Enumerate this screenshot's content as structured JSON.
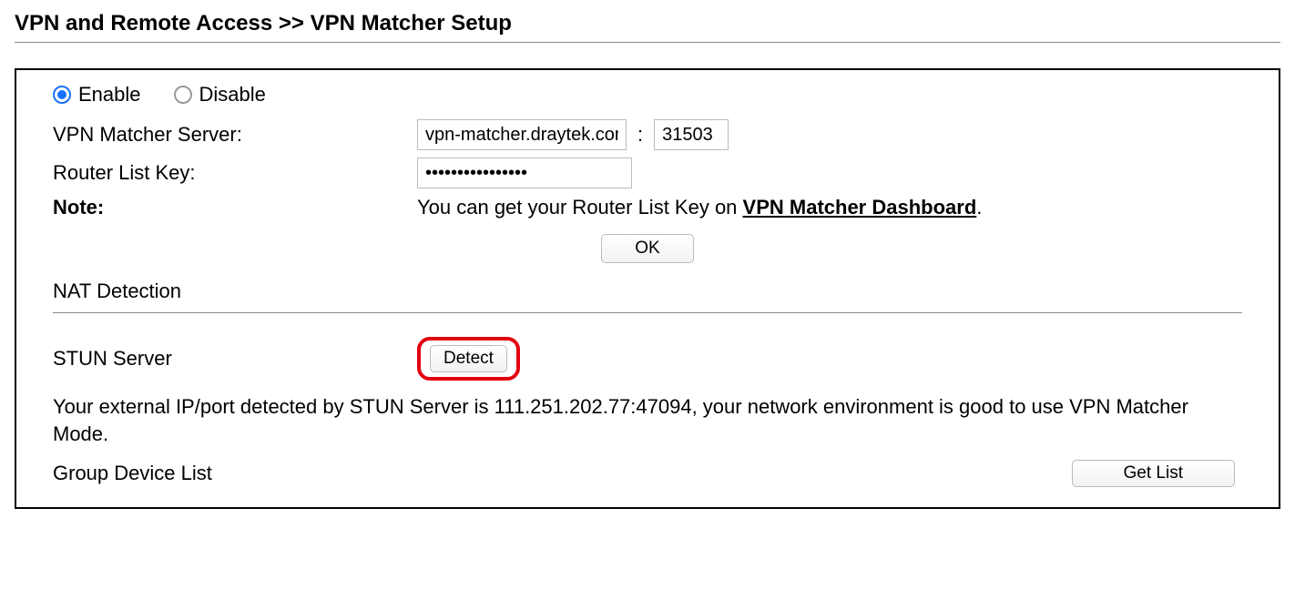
{
  "header": {
    "breadcrumb": "VPN and Remote Access >> VPN Matcher Setup"
  },
  "enable_toggle": {
    "enable_label": "Enable",
    "disable_label": "Disable",
    "selected": "enable"
  },
  "server": {
    "label": "VPN Matcher Server:",
    "host_value": "vpn-matcher.draytek.com",
    "colon": ":",
    "port_value": "31503"
  },
  "router_key": {
    "label": "Router List Key:",
    "value": "••••••••••••••••"
  },
  "note": {
    "label": "Note:",
    "text_prefix": "You can get your Router List Key on ",
    "link_text": "VPN Matcher Dashboard",
    "text_suffix": "."
  },
  "buttons": {
    "ok": "OK",
    "detect": "Detect",
    "get_list": "Get List"
  },
  "nat": {
    "heading": "NAT Detection",
    "stun_label": "STUN Server",
    "result_text": "Your external IP/port detected by STUN Server is 111.251.202.77:47094, your network environment is good to use VPN Matcher Mode."
  },
  "group": {
    "label": "Group Device List"
  }
}
